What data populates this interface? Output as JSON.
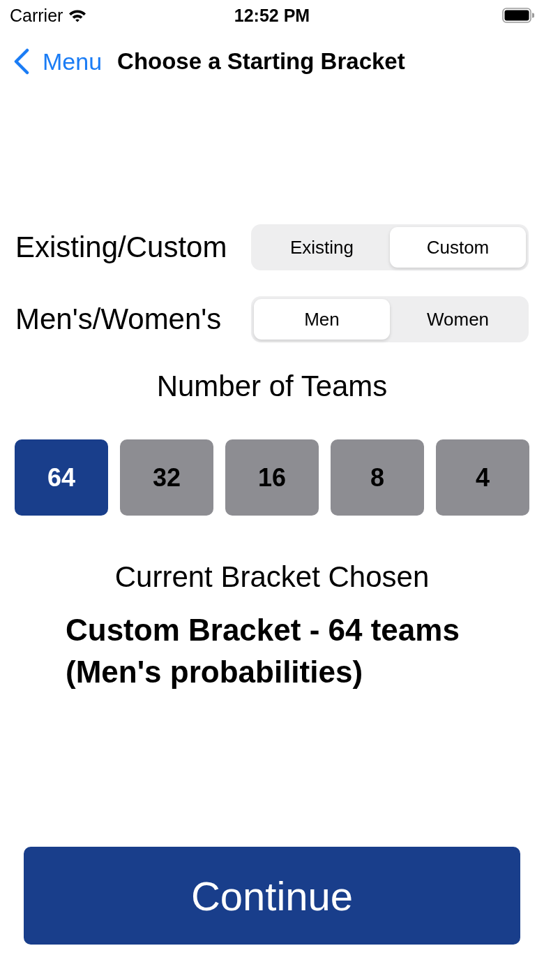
{
  "status_bar": {
    "carrier": "Carrier",
    "time": "12:52 PM"
  },
  "nav_bar": {
    "back_label": "Menu",
    "title": "Choose a Starting Bracket"
  },
  "settings": [
    {
      "label": "Existing/Custom",
      "segments": [
        {
          "label": "Existing",
          "selected": false
        },
        {
          "label": "Custom",
          "selected": true
        }
      ]
    },
    {
      "label": "Men's/Women's",
      "segments": [
        {
          "label": "Men",
          "selected": true
        },
        {
          "label": "Women",
          "selected": false
        }
      ]
    }
  ],
  "teams_section": {
    "heading": "Number of Teams",
    "options": [
      {
        "label": "64",
        "selected": true
      },
      {
        "label": "32",
        "selected": false
      },
      {
        "label": "16",
        "selected": false
      },
      {
        "label": "8",
        "selected": false
      },
      {
        "label": "4",
        "selected": false
      }
    ]
  },
  "current_bracket": {
    "heading": "Current Bracket Chosen",
    "description": "Custom Bracket - 64 teams\n(Men's probabilities)"
  },
  "continue_button": {
    "label": "Continue"
  }
}
